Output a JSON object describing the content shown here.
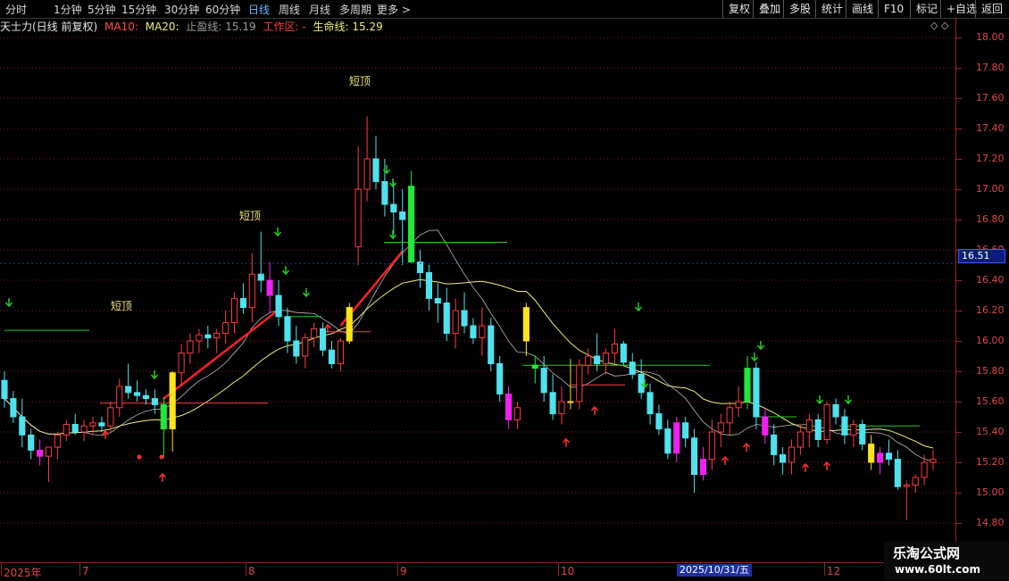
{
  "toolbar": {
    "periods": [
      {
        "label": "分时"
      },
      {
        "label": "1分钟"
      },
      {
        "label": "5分钟"
      },
      {
        "label": "15分钟"
      },
      {
        "label": "30分钟"
      },
      {
        "label": "60分钟"
      },
      {
        "label": "日线",
        "active": true
      },
      {
        "label": "周线"
      },
      {
        "label": "月线"
      },
      {
        "label": "多周期"
      },
      {
        "label": "更多 >"
      }
    ],
    "right_buttons": [
      "复权",
      "叠加",
      "多股",
      "统计",
      "画线",
      "F10",
      "标记",
      "+自选",
      "返回"
    ]
  },
  "info": {
    "stock": "天士力(日线 前复权)",
    "ma10": "MA10:",
    "ma20": "MA20:",
    "stop": "止盈线: 15.19",
    "zone": "工作区: -",
    "life": "生命线: 15.29"
  },
  "colors": {
    "up": "#ff3b3b",
    "down": "#4ee2ef",
    "ma10": "#e8e8e8",
    "ma20": "#f0ef7a",
    "life": "#ff2020",
    "signal_up": "#ff3030",
    "signal_down": "#22d022",
    "bar_yellow": "#ffe31a",
    "bar_green": "#22e83a",
    "bar_magenta": "#f020f0",
    "label": "#f2e27a"
  },
  "price_axis": {
    "ticks": [
      "18.00",
      "17.80",
      "17.60",
      "17.40",
      "17.20",
      "17.00",
      "16.80",
      "16.60",
      "16.40",
      "16.20",
      "16.00",
      "15.80",
      "15.60",
      "15.40",
      "15.20",
      "15.00",
      "14.80"
    ]
  },
  "current_price": "16.51",
  "date_axis": {
    "labels": [
      "2025年",
      "7",
      "8",
      "9",
      "10",
      "12"
    ],
    "cursor": "2025/10/31/五"
  },
  "chart_labels": [
    "短顶",
    "短顶",
    "短顶"
  ],
  "watermark": {
    "title": "乐淘公式网",
    "url": "www.60lt.com"
  },
  "chart_data": {
    "type": "candlestick",
    "ylim": [
      14.7,
      18.1
    ],
    "candles": [
      [
        15.74,
        15.8,
        15.56,
        15.62
      ],
      [
        15.62,
        15.67,
        15.46,
        15.5
      ],
      [
        15.5,
        15.62,
        15.3,
        15.38
      ],
      [
        15.38,
        15.42,
        15.22,
        15.28
      ],
      [
        15.28,
        15.35,
        15.18,
        15.24
      ],
      [
        15.24,
        15.3,
        15.07,
        15.3
      ],
      [
        15.3,
        15.4,
        15.22,
        15.38
      ],
      [
        15.38,
        15.48,
        15.34,
        15.45
      ],
      [
        15.45,
        15.52,
        15.38,
        15.4
      ],
      [
        15.4,
        15.48,
        15.34,
        15.44
      ],
      [
        15.44,
        15.5,
        15.38,
        15.46
      ],
      [
        15.46,
        15.5,
        15.4,
        15.44
      ],
      [
        15.44,
        15.6,
        15.4,
        15.56
      ],
      [
        15.56,
        15.75,
        15.5,
        15.7
      ],
      [
        15.7,
        15.85,
        15.62,
        15.66
      ],
      [
        15.66,
        15.74,
        15.6,
        15.64
      ],
      [
        15.64,
        15.68,
        15.58,
        15.62
      ],
      [
        15.62,
        15.68,
        15.52,
        15.58
      ],
      [
        15.58,
        15.63,
        15.23,
        15.42
      ],
      [
        15.42,
        15.8,
        15.27,
        15.79
      ],
      [
        15.79,
        15.98,
        15.7,
        15.92
      ],
      [
        15.92,
        16.05,
        15.85,
        16.0
      ],
      [
        16.0,
        16.08,
        15.92,
        16.04
      ],
      [
        16.04,
        16.1,
        15.95,
        16.02
      ],
      [
        16.02,
        16.08,
        15.92,
        16.05
      ],
      [
        16.05,
        16.2,
        15.98,
        16.12
      ],
      [
        16.12,
        16.32,
        16.05,
        16.28
      ],
      [
        16.28,
        16.38,
        16.18,
        16.22
      ],
      [
        16.22,
        16.58,
        16.12,
        16.44
      ],
      [
        16.44,
        16.72,
        16.32,
        16.4
      ],
      [
        16.4,
        16.52,
        16.18,
        16.3
      ],
      [
        16.3,
        16.4,
        16.1,
        16.16
      ],
      [
        16.16,
        16.22,
        15.92,
        16.0
      ],
      [
        16.0,
        16.1,
        15.85,
        15.9
      ],
      [
        15.9,
        16.05,
        15.82,
        16.02
      ],
      [
        16.02,
        16.12,
        15.96,
        16.08
      ],
      [
        16.08,
        16.12,
        15.9,
        15.94
      ],
      [
        15.94,
        16.0,
        15.82,
        15.85
      ],
      [
        15.85,
        16.02,
        15.8,
        16.0
      ],
      [
        16.0,
        16.25,
        15.98,
        16.22
      ],
      [
        16.62,
        17.28,
        16.5,
        17.0
      ],
      [
        17.0,
        17.48,
        16.92,
        17.2
      ],
      [
        17.2,
        17.35,
        17.0,
        17.05
      ],
      [
        17.05,
        17.2,
        16.82,
        16.9
      ],
      [
        16.9,
        17.05,
        16.7,
        16.85
      ],
      [
        16.85,
        17.0,
        16.5,
        16.8
      ],
      [
        17.02,
        17.12,
        16.6,
        16.52
      ],
      [
        16.52,
        16.6,
        16.35,
        16.45
      ],
      [
        16.45,
        16.5,
        16.2,
        16.28
      ],
      [
        16.28,
        16.38,
        16.12,
        16.25
      ],
      [
        16.25,
        16.35,
        16.0,
        16.05
      ],
      [
        16.05,
        16.28,
        15.95,
        16.2
      ],
      [
        16.2,
        16.32,
        16.05,
        16.1
      ],
      [
        16.1,
        16.15,
        15.98,
        16.02
      ],
      [
        16.02,
        16.22,
        15.9,
        16.1
      ],
      [
        16.1,
        16.15,
        15.8,
        15.85
      ],
      [
        15.85,
        15.9,
        15.6,
        15.65
      ],
      [
        15.65,
        15.7,
        15.42,
        15.48
      ],
      [
        15.48,
        15.6,
        15.42,
        15.56
      ],
      [
        16.0,
        16.25,
        15.9,
        16.22
      ],
      [
        15.84,
        15.9,
        15.72,
        15.82
      ],
      [
        15.82,
        15.9,
        15.6,
        15.66
      ],
      [
        15.66,
        15.78,
        15.48,
        15.52
      ],
      [
        15.52,
        15.7,
        15.45,
        15.6
      ],
      [
        15.6,
        15.88,
        15.55,
        15.6
      ],
      [
        15.6,
        15.88,
        15.55,
        15.84
      ],
      [
        15.84,
        15.95,
        15.78,
        15.9
      ],
      [
        15.9,
        16.05,
        15.8,
        15.85
      ],
      [
        15.85,
        15.95,
        15.78,
        15.92
      ],
      [
        15.92,
        16.08,
        15.85,
        15.98
      ],
      [
        15.98,
        16.0,
        15.84,
        15.86
      ],
      [
        15.86,
        15.92,
        15.75,
        15.78
      ],
      [
        15.78,
        15.88,
        15.62,
        15.66
      ],
      [
        15.66,
        15.72,
        15.45,
        15.52
      ],
      [
        15.52,
        15.58,
        15.38,
        15.42
      ],
      [
        15.42,
        15.48,
        15.22,
        15.26
      ],
      [
        15.26,
        15.5,
        15.2,
        15.46
      ],
      [
        15.46,
        15.5,
        15.3,
        15.36
      ],
      [
        15.36,
        15.42,
        15.0,
        15.12
      ],
      [
        15.12,
        15.3,
        15.08,
        15.22
      ],
      [
        15.22,
        15.48,
        15.15,
        15.4
      ],
      [
        15.4,
        15.52,
        15.3,
        15.46
      ],
      [
        15.46,
        15.6,
        15.38,
        15.56
      ],
      [
        15.56,
        15.7,
        15.5,
        15.6
      ],
      [
        15.6,
        15.9,
        15.55,
        15.82
      ],
      [
        15.82,
        15.86,
        15.42,
        15.5
      ],
      [
        15.5,
        15.55,
        15.32,
        15.38
      ],
      [
        15.38,
        15.45,
        15.18,
        15.25
      ],
      [
        15.25,
        15.3,
        15.12,
        15.2
      ],
      [
        15.2,
        15.35,
        15.12,
        15.3
      ],
      [
        15.3,
        15.45,
        15.25,
        15.4
      ],
      [
        15.4,
        15.52,
        15.3,
        15.48
      ],
      [
        15.48,
        15.52,
        15.3,
        15.35
      ],
      [
        15.35,
        15.6,
        15.32,
        15.58
      ],
      [
        15.58,
        15.62,
        15.45,
        15.5
      ],
      [
        15.5,
        15.55,
        15.32,
        15.38
      ],
      [
        15.38,
        15.48,
        15.3,
        15.45
      ],
      [
        15.45,
        15.48,
        15.28,
        15.32
      ],
      [
        15.32,
        15.38,
        15.15,
        15.2
      ],
      [
        15.2,
        15.3,
        15.12,
        15.26
      ],
      [
        15.26,
        15.35,
        15.18,
        15.22
      ],
      [
        15.22,
        15.28,
        15.02,
        15.04
      ],
      [
        15.04,
        15.08,
        14.82,
        15.05
      ],
      [
        15.05,
        15.12,
        15.0,
        15.1
      ],
      [
        15.1,
        15.25,
        15.05,
        15.2
      ],
      [
        15.2,
        15.28,
        15.15,
        15.22
      ]
    ]
  }
}
